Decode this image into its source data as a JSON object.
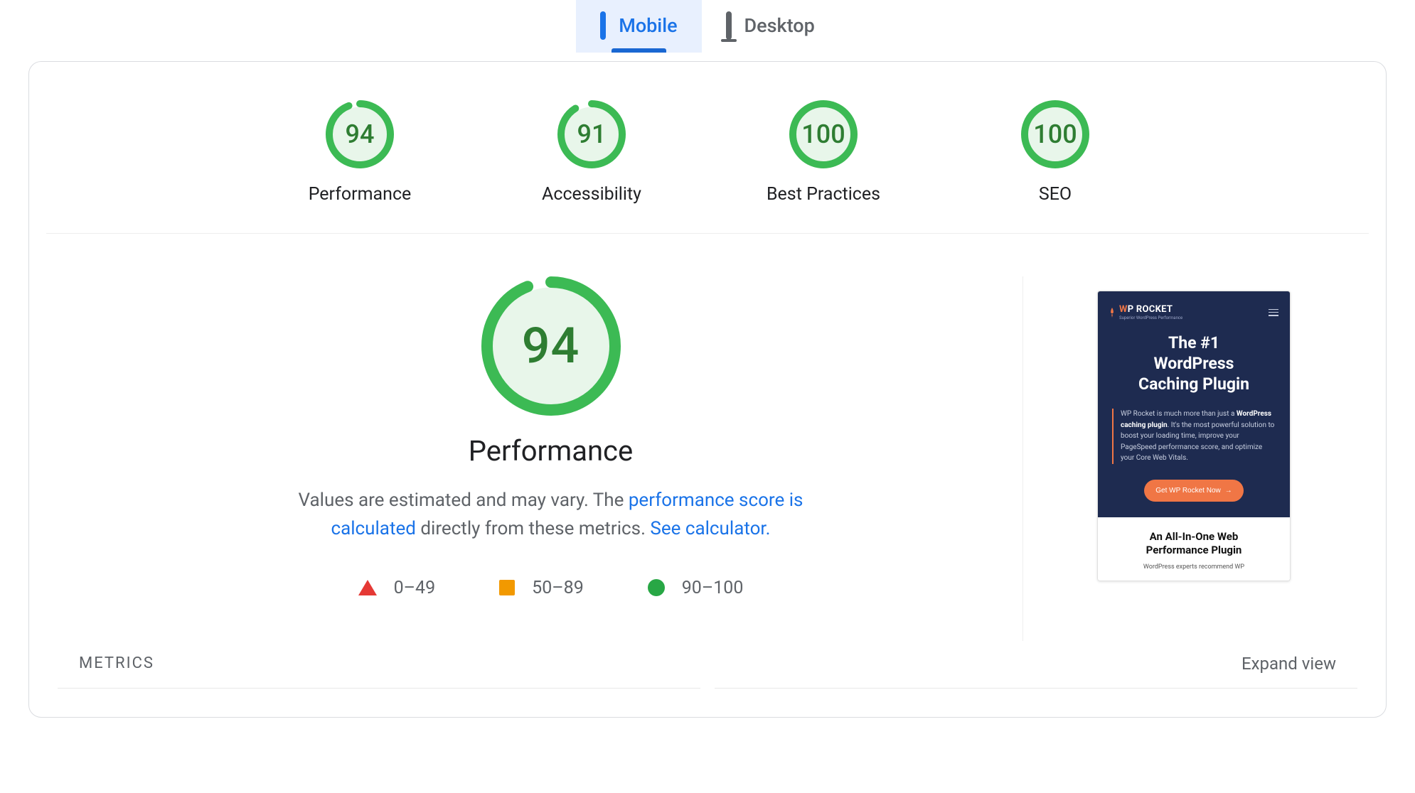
{
  "tabs": {
    "mobile_label": "Mobile",
    "desktop_label": "Desktop",
    "active": "mobile"
  },
  "scores": {
    "performance": {
      "value": 94,
      "label": "Performance"
    },
    "accessibility": {
      "value": 91,
      "label": "Accessibility"
    },
    "best_practices": {
      "value": 100,
      "label": "Best Practices"
    },
    "seo": {
      "value": 100,
      "label": "SEO"
    }
  },
  "performance_section": {
    "score": 94,
    "title": "Performance",
    "desc_pre": "Values are estimated and may vary. The ",
    "link1": "performance score is calculated",
    "desc_mid": " directly from these metrics. ",
    "link2": "See calculator.",
    "legend": {
      "low": "0–49",
      "mid": "50–89",
      "high": "90–100"
    }
  },
  "preview": {
    "brand_w": "W",
    "brand_p": "P",
    "brand_rest": "ROCKET",
    "brand_sub": "Superior WordPress Performance",
    "headline_l1": "The #1",
    "headline_l2": "WordPress",
    "headline_l3": "Caching Plugin",
    "body_pre": "WP Rocket is much more than just a ",
    "body_bold": "WordPress caching plugin",
    "body_post": ". It's the most powerful solution to boost your loading time, improve your PageSpeed performance score, and optimize your Core Web Vitals.",
    "cta_label": "Get WP Rocket Now",
    "below_t1_a": "An All-In-One Web",
    "below_t1_b": "Performance Plugin",
    "below_t2": "WordPress experts recommend WP"
  },
  "metrics": {
    "title": "METRICS",
    "expand_label": "Expand view"
  },
  "colors": {
    "green": "#3cba54",
    "green_fill": "#e8f6ea"
  }
}
